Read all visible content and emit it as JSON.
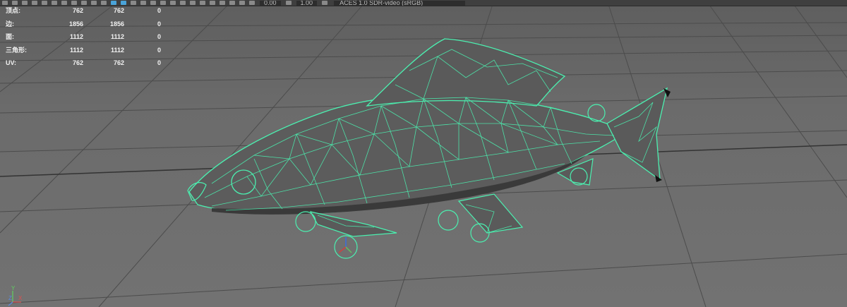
{
  "toolbar": {
    "field_a": "0.00",
    "field_b": "1.00",
    "color_space": "ACES 1.0 SDR-video (sRGB)"
  },
  "hud": {
    "rows": [
      {
        "label": "顶点:",
        "v1": "762",
        "v2": "762",
        "v3": "0"
      },
      {
        "label": "边:",
        "v1": "1856",
        "v2": "1856",
        "v3": "0"
      },
      {
        "label": "面:",
        "v1": "1112",
        "v2": "1112",
        "v3": "0"
      },
      {
        "label": "三角形:",
        "v1": "1112",
        "v2": "1112",
        "v3": "0"
      },
      {
        "label": "UV:",
        "v1": "762",
        "v2": "762",
        "v3": "0"
      }
    ]
  },
  "axes": {
    "x": "X",
    "y": "Y",
    "z": "Z"
  },
  "colors": {
    "wireframe": "#4bf0b0",
    "grid": "#4a4a4a",
    "viewport_bg": "#6a6a6a",
    "toolbar_bg": "#3f3f3f"
  }
}
